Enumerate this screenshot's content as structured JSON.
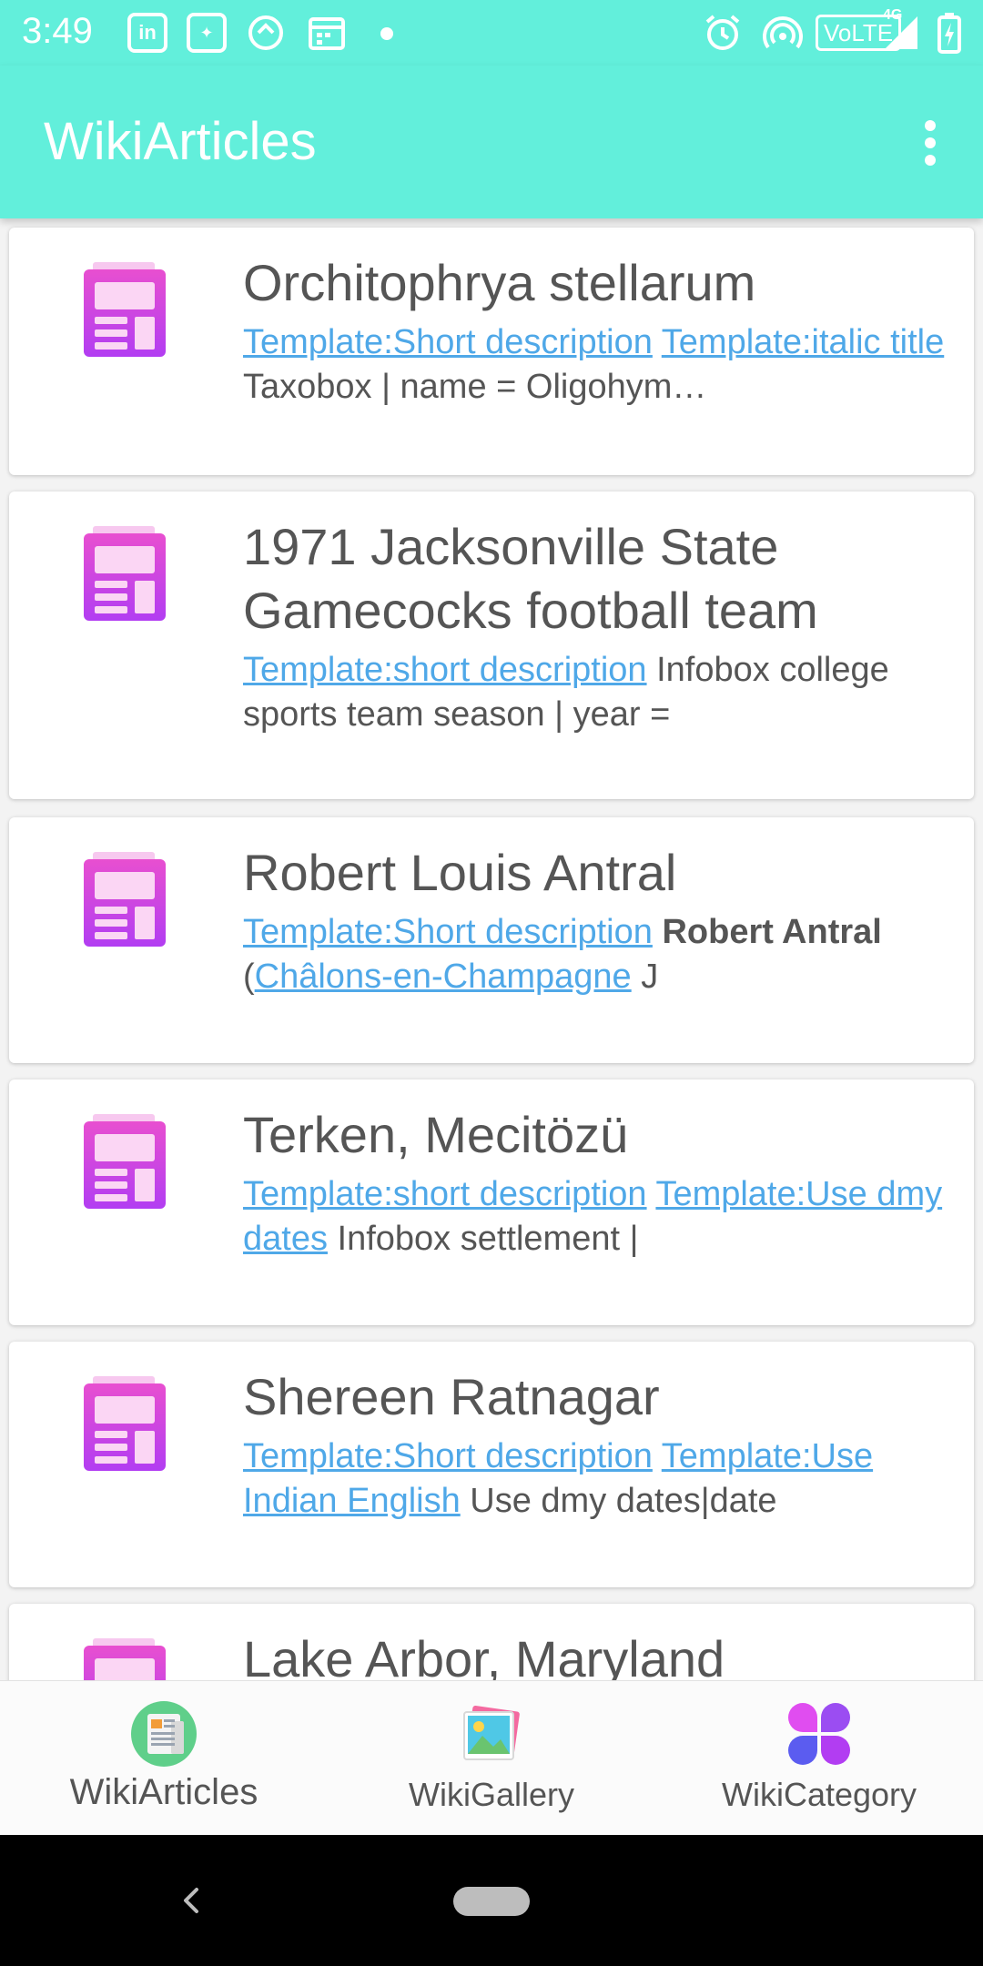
{
  "status_bar": {
    "time": "3:49",
    "left_icons": [
      "linkedin-icon",
      "hotstar-icon",
      "sync-icon",
      "calendar-icon",
      "dot-icon"
    ],
    "right_icons": [
      "alarm-icon",
      "hotspot-icon",
      "volte-icon",
      "signal-4g-icon",
      "battery-charging-icon"
    ],
    "volte_label": "VoLTE",
    "network_label": "4G"
  },
  "app_bar": {
    "title": "WikiArticles",
    "menu_icon": "more-vert-icon"
  },
  "articles": [
    {
      "title": "Orchitophrya stellarum",
      "snippet": [
        {
          "t": "Template:Short description",
          "link": true
        },
        {
          "t": " "
        },
        {
          "t": "Template:italic title",
          "link": true
        },
        {
          "t": " Taxobox | name = Oligohym…"
        }
      ]
    },
    {
      "title": "1971 Jacksonville State Gamecocks football team",
      "snippet": [
        {
          "t": "Template:short description",
          "link": true
        },
        {
          "t": " Infobox college sports team season | year ="
        }
      ]
    },
    {
      "title": "Robert Louis Antral",
      "snippet": [
        {
          "t": "Template:Short description",
          "link": true
        },
        {
          "t": " "
        },
        {
          "t": "Robert Antral",
          "bold": true
        },
        {
          "t": " ("
        },
        {
          "t": "Châlons-en-Champagne",
          "link": true
        },
        {
          "t": " J"
        }
      ]
    },
    {
      "title": "Terken, Mecitözü",
      "snippet": [
        {
          "t": "Template:short description",
          "link": true
        },
        {
          "t": " "
        },
        {
          "t": "Template:Use dmy dates",
          "link": true
        },
        {
          "t": " Infobox settlement |"
        }
      ]
    },
    {
      "title": "Shereen Ratnagar",
      "snippet": [
        {
          "t": "Template:Short description",
          "link": true
        },
        {
          "t": " "
        },
        {
          "t": "Template:Use Indian English",
          "link": true
        },
        {
          "t": " Use dmy dates|date"
        }
      ]
    },
    {
      "title": "Lake Arbor, Maryland",
      "snippet": []
    }
  ],
  "bottom_nav": {
    "items": [
      {
        "label": "WikiArticles",
        "icon": "articles-icon",
        "active": true
      },
      {
        "label": "WikiGallery",
        "icon": "gallery-icon",
        "active": false
      },
      {
        "label": "WikiCategory",
        "icon": "category-icon",
        "active": false
      }
    ]
  },
  "colors": {
    "accent": "#62efdb",
    "link": "#4fa8e8",
    "icon_gradient_start": "#e84fd0",
    "icon_gradient_end": "#b23df2"
  }
}
